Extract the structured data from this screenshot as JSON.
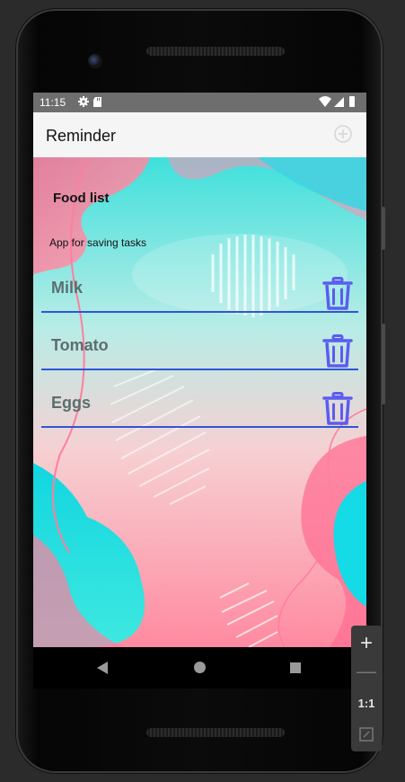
{
  "status_bar": {
    "time": "11:15"
  },
  "app_bar": {
    "title": "Reminder"
  },
  "main": {
    "list_title": "Food list",
    "subtitle": "App for saving tasks",
    "items": [
      {
        "label": "Milk"
      },
      {
        "label": "Tomato"
      },
      {
        "label": "Eggs"
      }
    ]
  },
  "zoom_controls": {
    "one_to_one_label": "1:1"
  },
  "colors": {
    "accent_line": "#2f55d8",
    "trash_icon": "#5b5cf0",
    "item_text": "#5c6e6e"
  }
}
